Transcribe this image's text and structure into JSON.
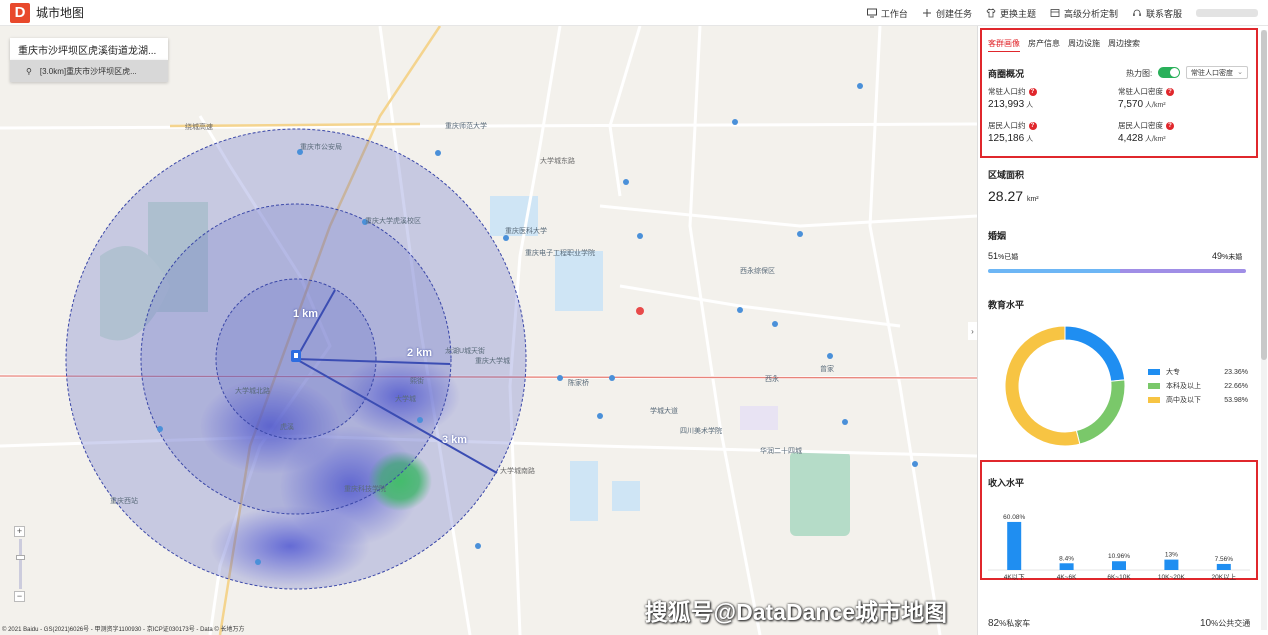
{
  "app": {
    "logo_letter": "D",
    "title": "城市地图"
  },
  "topbar": {
    "actions": [
      {
        "icon": "monitor-icon",
        "label": "工作台"
      },
      {
        "icon": "plus-icon",
        "label": "创建任务"
      },
      {
        "icon": "shirt-icon",
        "label": "更换主题"
      },
      {
        "icon": "table-icon",
        "label": "高级分析定制"
      },
      {
        "icon": "headset-icon",
        "label": "联系客服"
      }
    ]
  },
  "map": {
    "search_text": "重庆市沙坪坝区虎溪街道龙湖...",
    "result_text": "[3.0km]重庆市沙坪坝区虎...",
    "radius_labels": [
      "1 km",
      "2 km",
      "3 km"
    ],
    "copyright": "© 2021 Baidu - GS(2021)6026号 - 甲测资字1100930 - 京ICP证030173号 - Data © 长地万方",
    "watermark": "搜狐号@DataDance城市地图",
    "road_labels": [
      "绕城高速",
      "大学城东路",
      "大学城南路"
    ],
    "pois": [
      "重庆市公安局",
      "重庆大学虎溪校区",
      "重庆师范大学",
      "重庆医科大学",
      "四川美术学院",
      "大学城",
      "重庆科技学院",
      "重庆电子工程职业学院",
      "西永",
      "陈家桥",
      "重庆大学城",
      "虎溪",
      "熙街",
      "曾家",
      "重庆西站",
      "华润二十四城",
      "西永综保区",
      "龙湖U城天街",
      "大学城北路",
      "学城大道"
    ]
  },
  "panel": {
    "tabs": [
      "客群画像",
      "房产信息",
      "周边设施",
      "周边搜索"
    ],
    "active_tab": 0,
    "business": {
      "title": "商圈概况",
      "heatmap_label": "热力图",
      "heatmap_on": true,
      "select_value": "常驻人口密度",
      "stats": [
        {
          "label": "常驻人口约",
          "value": "213,993",
          "unit": "人"
        },
        {
          "label": "常驻人口密度",
          "value": "7,570",
          "unit": "人/km²"
        },
        {
          "label": "居民人口约",
          "value": "125,186",
          "unit": "人"
        },
        {
          "label": "居民人口密度",
          "value": "4,428",
          "unit": "人/km²"
        }
      ]
    },
    "area": {
      "title": "区域面积",
      "value": "28.27",
      "unit": "km²"
    },
    "marriage": {
      "title": "婚姻",
      "married_pct": 51,
      "unmarried_pct": 49,
      "married_label": "已婚",
      "unmarried_label": "未婚",
      "married_color": "#6db6f5",
      "unmarried_color": "#a08ee6"
    },
    "education": {
      "title": "教育水平",
      "items": [
        {
          "name": "大专",
          "value": 23.36,
          "label": "23.36%",
          "color": "#1f8ef1"
        },
        {
          "name": "本科及以上",
          "value": 22.66,
          "label": "22.66%",
          "color": "#7ac86a"
        },
        {
          "name": "高中及以下",
          "value": 53.98,
          "label": "53.98%",
          "color": "#f7c443"
        }
      ]
    },
    "income": {
      "title": "收入水平",
      "color": "#1f8ef1"
    },
    "footer": {
      "left_value": "82",
      "left_unit": "%私家车",
      "right_value": "10",
      "right_unit": "%公共交通"
    }
  },
  "chart_data": {
    "type": "bar",
    "title": "收入水平",
    "categories": [
      "4K以下",
      "4K~6K",
      "6K~10K",
      "10K~20K",
      "20K以上"
    ],
    "values": [
      60.08,
      8.4,
      10.96,
      13,
      7.56
    ],
    "value_labels": [
      "60.08%",
      "8.4%",
      "10.96%",
      "13%",
      "7.56%"
    ],
    "ylim": [
      0,
      70
    ],
    "grid": false
  }
}
